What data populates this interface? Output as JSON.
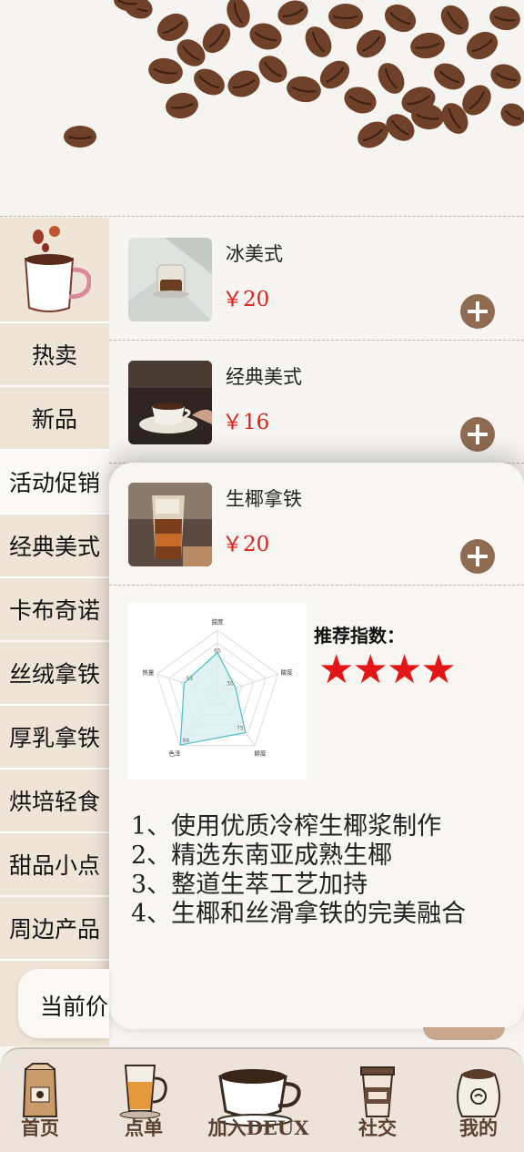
{
  "sidebar": {
    "items": [
      {
        "label": "热卖"
      },
      {
        "label": "新品"
      },
      {
        "label": "活动促销"
      },
      {
        "label": "经典美式"
      },
      {
        "label": "卡布奇诺"
      },
      {
        "label": "丝绒拿铁"
      },
      {
        "label": "厚乳拿铁"
      },
      {
        "label": "烘培轻食"
      },
      {
        "label": "甜品小点"
      },
      {
        "label": "周边产品"
      }
    ],
    "active_label": "活动促销"
  },
  "products": [
    {
      "name": "冰美式",
      "price": "￥20"
    },
    {
      "name": "经典美式",
      "price": "￥16"
    }
  ],
  "detail": {
    "name": "生椰拿铁",
    "price": "￥20",
    "recommend_label": "推荐指数：",
    "stars": "★★★★",
    "rating": 4,
    "description": [
      "1、使用优质冷榨生椰浆制作",
      "2、精选东南亚成熟生椰",
      "3、整道生萃工艺加持",
      "4、生椰和丝滑拿铁的完美融合"
    ]
  },
  "chart_data": {
    "type": "radar",
    "axes": [
      "甜度",
      "酸度",
      "醇度",
      "色泽",
      "热量"
    ],
    "values": [
      65,
      30,
      75,
      99,
      55
    ],
    "max": 100,
    "colors": {
      "fill": "#d8efef",
      "stroke": "#4bbfc2"
    }
  },
  "price_bar": {
    "label": "当前价"
  },
  "tabbar": {
    "tabs": [
      {
        "label": "首页",
        "icon": "coffee-bag-icon"
      },
      {
        "label": "点单",
        "icon": "iced-coffee-icon"
      },
      {
        "label": "加入DEUX",
        "icon": "coffee-cup-icon"
      },
      {
        "label": "社交",
        "icon": "takeaway-cup-icon"
      },
      {
        "label": "我的",
        "icon": "coffee-sack-icon"
      }
    ]
  },
  "colors": {
    "accent": "#8f6b52",
    "price": "#e0201a",
    "star": "#e31515",
    "sidebar_bg": "#eee5d7"
  }
}
